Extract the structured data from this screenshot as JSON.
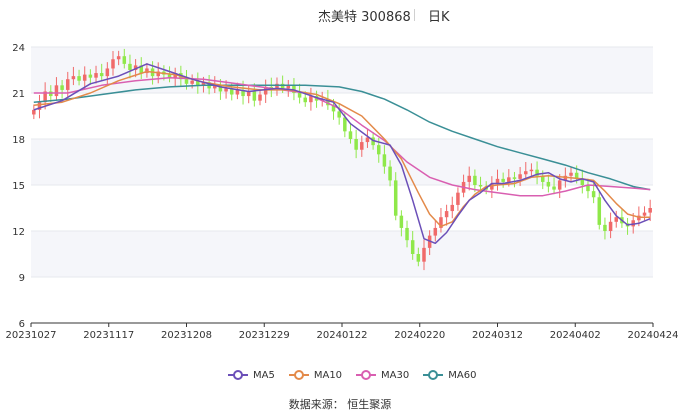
{
  "header": {
    "title": "杰美特 300868",
    "period": "日K"
  },
  "source": "数据来源：  恒生聚源",
  "chart_data": {
    "type": "candlestick",
    "ylim": [
      6,
      24
    ],
    "yticks": [
      "24",
      "21",
      "18",
      "15",
      "12",
      "9",
      "6"
    ],
    "xticks": [
      "20231027",
      "20231117",
      "20231208",
      "20231229",
      "20240122",
      "20240220",
      "20240312",
      "20240402",
      "20240424"
    ],
    "colors": {
      "up": "#f06a6a",
      "down": "#8fe84a",
      "MA5": "#6b4fb8",
      "MA10": "#e38a4a",
      "MA30": "#d95fb1",
      "MA60": "#3a8f96"
    },
    "legend": [
      "MA5",
      "MA10",
      "MA30",
      "MA60"
    ],
    "closes": [
      19.9,
      20.4,
      21.1,
      20.8,
      21.5,
      21.2,
      21.9,
      22.1,
      21.8,
      22.2,
      22.0,
      22.3,
      22.1,
      22.6,
      23.2,
      23.4,
      22.9,
      22.5,
      22.8,
      22.3,
      22.6,
      22.1,
      22.4,
      22.2,
      22.0,
      22.3,
      21.9,
      21.6,
      21.8,
      21.5,
      21.7,
      21.3,
      21.5,
      21.1,
      21.3,
      20.9,
      21.2,
      20.8,
      21.1,
      20.5,
      20.9,
      21.4,
      21.2,
      21.6,
      21.3,
      21.5,
      21.0,
      20.7,
      20.4,
      20.8,
      20.5,
      20.6,
      20.2,
      19.8,
      19.4,
      18.5,
      18.0,
      17.3,
      17.8,
      18.1,
      17.6,
      17.0,
      16.2,
      15.3,
      13.0,
      12.2,
      11.4,
      10.5,
      10.0,
      10.9,
      11.7,
      12.2,
      12.9,
      13.3,
      13.7,
      14.5,
      15.2,
      15.6,
      15.0,
      14.9,
      14.7,
      15.1,
      15.4,
      15.2,
      15.5,
      15.4,
      15.7,
      15.9,
      16.0,
      15.6,
      15.2,
      14.9,
      14.7,
      15.3,
      15.6,
      15.8,
      15.4,
      15.0,
      14.6,
      14.2,
      12.4,
      12.0,
      12.6,
      12.9,
      12.5,
      12.3,
      12.7,
      13.0,
      13.2,
      13.5
    ],
    "ma": {
      "MA5": [
        [
          0,
          19.9
        ],
        [
          5,
          20.5
        ],
        [
          10,
          21.6
        ],
        [
          15,
          22.1
        ],
        [
          20,
          22.9
        ],
        [
          24,
          22.4
        ],
        [
          28,
          21.9
        ],
        [
          33,
          21.4
        ],
        [
          38,
          21.1
        ],
        [
          43,
          21.3
        ],
        [
          46,
          21.2
        ],
        [
          50,
          20.7
        ],
        [
          53,
          20.4
        ],
        [
          56,
          19.0
        ],
        [
          60,
          17.9
        ],
        [
          63,
          17.6
        ],
        [
          65,
          16.3
        ],
        [
          67,
          14.0
        ],
        [
          69,
          11.5
        ],
        [
          71,
          11.2
        ],
        [
          73,
          11.9
        ],
        [
          75,
          13.0
        ],
        [
          77,
          14.0
        ],
        [
          79,
          14.5
        ],
        [
          81,
          15.1
        ],
        [
          83,
          15.1
        ],
        [
          86,
          15.3
        ],
        [
          89,
          15.7
        ],
        [
          91,
          15.8
        ],
        [
          93,
          15.4
        ],
        [
          95,
          15.2
        ],
        [
          97,
          15.4
        ],
        [
          99,
          15.2
        ],
        [
          101,
          14.0
        ],
        [
          103,
          13.0
        ],
        [
          105,
          12.4
        ],
        [
          107,
          12.5
        ],
        [
          109,
          12.8
        ]
      ],
      "MA10": [
        [
          0,
          20.2
        ],
        [
          5,
          20.4
        ],
        [
          10,
          21.0
        ],
        [
          15,
          21.8
        ],
        [
          20,
          22.4
        ],
        [
          25,
          22.2
        ],
        [
          30,
          21.7
        ],
        [
          35,
          21.4
        ],
        [
          40,
          21.2
        ],
        [
          45,
          21.2
        ],
        [
          50,
          20.9
        ],
        [
          54,
          20.3
        ],
        [
          58,
          19.5
        ],
        [
          62,
          18.0
        ],
        [
          65,
          16.7
        ],
        [
          68,
          14.5
        ],
        [
          70,
          13.1
        ],
        [
          72,
          12.3
        ],
        [
          74,
          12.6
        ],
        [
          76,
          13.6
        ],
        [
          78,
          14.4
        ],
        [
          80,
          14.9
        ],
        [
          82,
          15.0
        ],
        [
          85,
          15.1
        ],
        [
          88,
          15.5
        ],
        [
          91,
          15.6
        ],
        [
          94,
          15.5
        ],
        [
          97,
          15.4
        ],
        [
          99,
          15.3
        ],
        [
          101,
          14.6
        ],
        [
          103,
          13.8
        ],
        [
          105,
          13.1
        ],
        [
          107,
          12.9
        ],
        [
          109,
          12.9
        ]
      ],
      "MA30": [
        [
          0,
          21.0
        ],
        [
          6,
          21.0
        ],
        [
          12,
          21.5
        ],
        [
          18,
          21.8
        ],
        [
          24,
          22.0
        ],
        [
          30,
          21.9
        ],
        [
          36,
          21.6
        ],
        [
          42,
          21.3
        ],
        [
          48,
          21.0
        ],
        [
          54,
          20.0
        ],
        [
          58,
          18.9
        ],
        [
          62,
          17.9
        ],
        [
          66,
          16.5
        ],
        [
          70,
          15.5
        ],
        [
          74,
          15.0
        ],
        [
          78,
          14.7
        ],
        [
          82,
          14.5
        ],
        [
          86,
          14.3
        ],
        [
          90,
          14.3
        ],
        [
          94,
          14.6
        ],
        [
          98,
          15.0
        ],
        [
          102,
          14.9
        ],
        [
          106,
          14.8
        ],
        [
          109,
          14.7
        ]
      ],
      "MA60": [
        [
          0,
          20.4
        ],
        [
          6,
          20.6
        ],
        [
          12,
          20.9
        ],
        [
          18,
          21.2
        ],
        [
          24,
          21.4
        ],
        [
          30,
          21.5
        ],
        [
          36,
          21.5
        ],
        [
          42,
          21.5
        ],
        [
          48,
          21.5
        ],
        [
          54,
          21.4
        ],
        [
          58,
          21.1
        ],
        [
          62,
          20.6
        ],
        [
          66,
          19.9
        ],
        [
          70,
          19.1
        ],
        [
          74,
          18.5
        ],
        [
          78,
          18.0
        ],
        [
          82,
          17.5
        ],
        [
          86,
          17.1
        ],
        [
          90,
          16.7
        ],
        [
          94,
          16.3
        ],
        [
          98,
          15.8
        ],
        [
          102,
          15.4
        ],
        [
          106,
          14.9
        ],
        [
          109,
          14.7
        ]
      ]
    }
  }
}
